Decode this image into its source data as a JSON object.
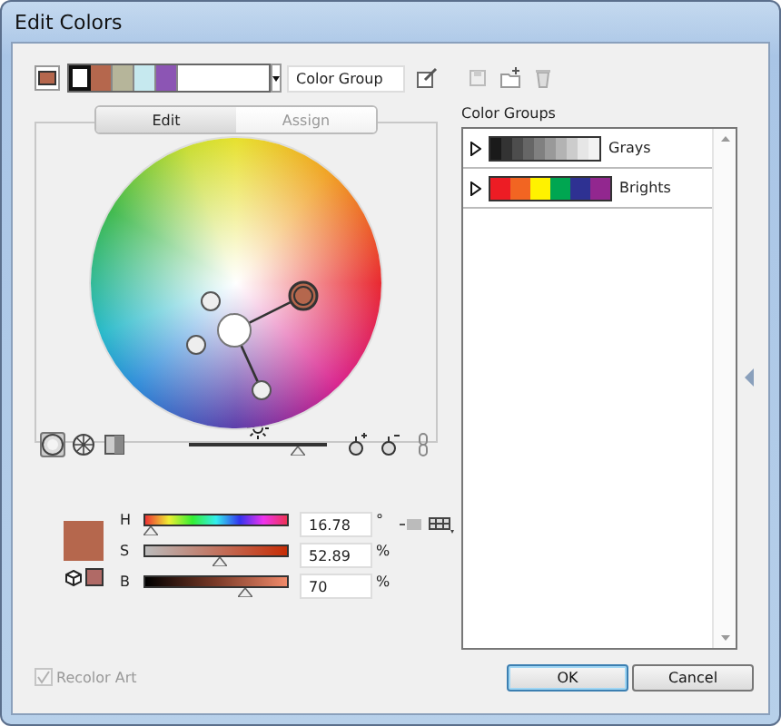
{
  "window": {
    "title": "Edit Colors"
  },
  "current_color": {
    "color": "#b5674d"
  },
  "harmony": {
    "swatches": [
      {
        "color": "#ffffff",
        "selected": true
      },
      {
        "color": "#b5674d",
        "selected": false
      },
      {
        "color": "#b6b59a",
        "selected": false
      },
      {
        "color": "#c6e9ef",
        "selected": false
      },
      {
        "color": "#8c55b4",
        "selected": false
      }
    ]
  },
  "group_name": {
    "value": "Color Group"
  },
  "tabs": [
    {
      "label": "Edit",
      "selected": true
    },
    {
      "label": "Assign",
      "selected": false
    }
  ],
  "brightness": {
    "level": 0.79
  },
  "color_preview": {
    "color": "#b5674d"
  },
  "sliders": [
    {
      "label": "H",
      "kind": "hue",
      "level": 0.05,
      "value": "16.78",
      "unit": "°"
    },
    {
      "label": "S",
      "kind": "saturation",
      "level": 0.53,
      "value": "52.89",
      "unit": "%"
    },
    {
      "label": "B",
      "kind": "brightness",
      "level": 0.7,
      "value": "70",
      "unit": "%"
    }
  ],
  "recolor_art": {
    "label": "Recolor Art",
    "checked": true,
    "disabled": true
  },
  "color_groups": {
    "title": "Color Groups",
    "groups": [
      {
        "name": "Grays",
        "swatches": [
          {
            "color": "#1a1a1a"
          },
          {
            "color": "#333333"
          },
          {
            "color": "#4d4d4d"
          },
          {
            "color": "#666666"
          },
          {
            "color": "#808080"
          },
          {
            "color": "#999999"
          },
          {
            "color": "#b3b3b3"
          },
          {
            "color": "#cccccc"
          },
          {
            "color": "#e6e6e6"
          },
          {
            "color": "#f2f2f2"
          }
        ]
      },
      {
        "name": "Brights",
        "swatches": [
          {
            "color": "#ed1c24"
          },
          {
            "color": "#f26522"
          },
          {
            "color": "#fff200"
          },
          {
            "color": "#00a651"
          },
          {
            "color": "#2e3192"
          },
          {
            "color": "#92278f"
          }
        ]
      }
    ]
  },
  "buttons": [
    {
      "label": "OK",
      "default": true
    },
    {
      "label": "Cancel",
      "default": false
    }
  ]
}
